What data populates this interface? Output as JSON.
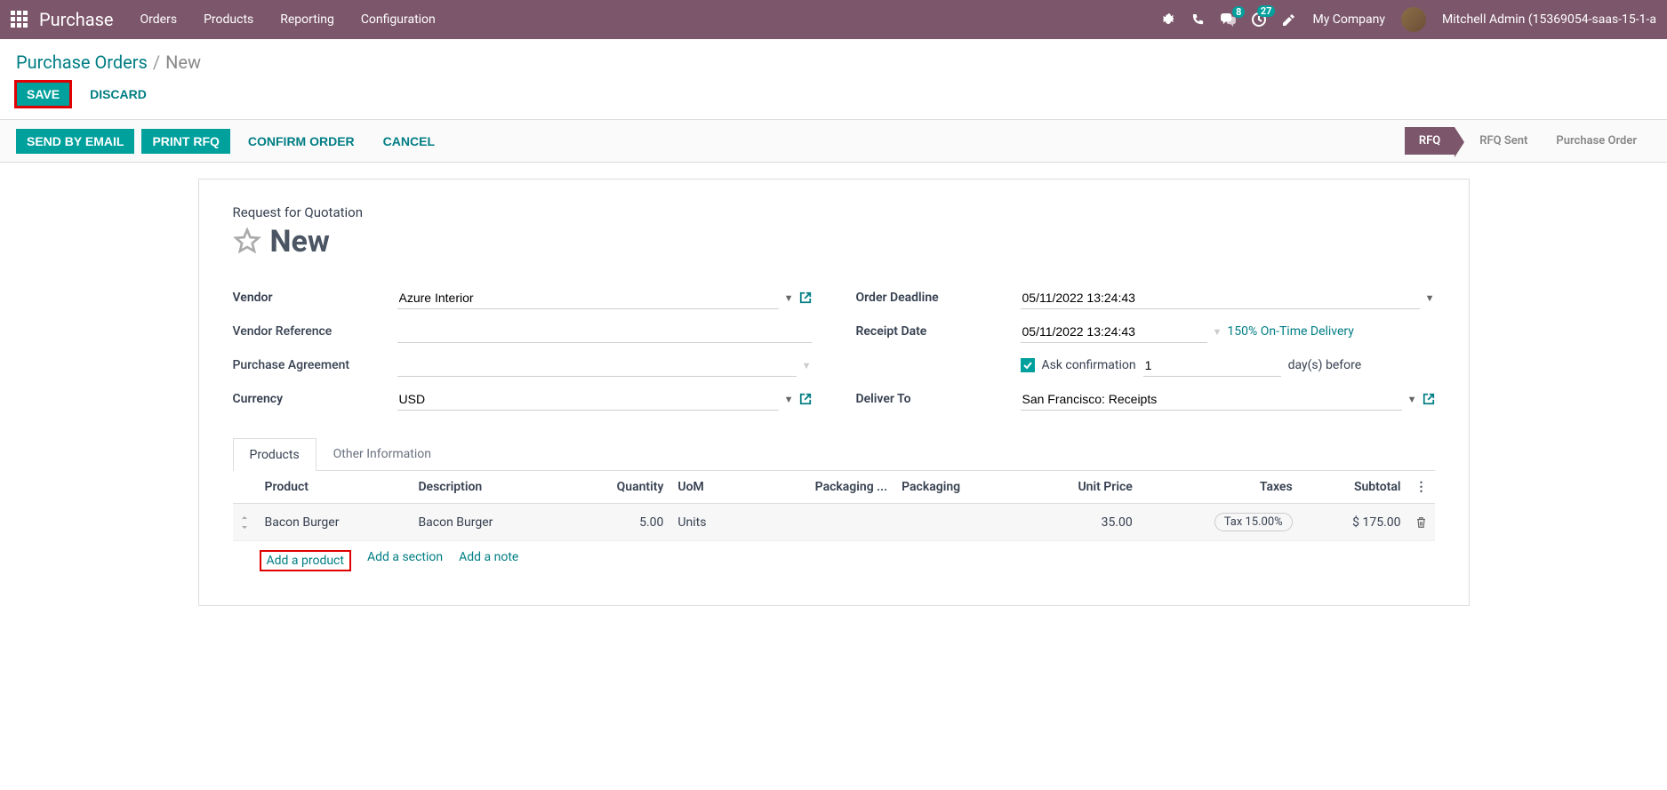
{
  "nav": {
    "app_title": "Purchase",
    "menu": [
      "Orders",
      "Products",
      "Reporting",
      "Configuration"
    ],
    "msg_count": "8",
    "activity_count": "27",
    "company": "My Company",
    "user": "Mitchell Admin (15369054-saas-15-1-a"
  },
  "breadcrumb": {
    "parent": "Purchase Orders",
    "current": "New"
  },
  "actions": {
    "save": "Save",
    "discard": "Discard"
  },
  "statusbar": {
    "send_email": "Send by Email",
    "print_rfq": "Print RFQ",
    "confirm": "Confirm Order",
    "cancel": "Cancel",
    "stages": [
      "RFQ",
      "RFQ Sent",
      "Purchase Order"
    ]
  },
  "form": {
    "subtitle": "Request for Quotation",
    "title": "New",
    "labels": {
      "vendor": "Vendor",
      "vendor_ref": "Vendor Reference",
      "purchase_agreement": "Purchase Agreement",
      "currency": "Currency",
      "order_deadline": "Order Deadline",
      "receipt_date": "Receipt Date",
      "deliver_to": "Deliver To",
      "ask_confirmation": "Ask confirmation",
      "days_before": "day(s) before"
    },
    "values": {
      "vendor": "Azure Interior",
      "vendor_ref": "",
      "purchase_agreement": "",
      "currency": "USD",
      "order_deadline": "05/11/2022 13:24:43",
      "receipt_date": "05/11/2022 13:24:43",
      "on_time_delivery": "150% On-Time Delivery",
      "ask_confirmation_days": "1",
      "deliver_to": "San Francisco: Receipts"
    }
  },
  "tabs": {
    "products": "Products",
    "other": "Other Information"
  },
  "table": {
    "headers": {
      "product": "Product",
      "description": "Description",
      "quantity": "Quantity",
      "uom": "UoM",
      "packaging_qty": "Packaging ...",
      "packaging": "Packaging",
      "unit_price": "Unit Price",
      "taxes": "Taxes",
      "subtotal": "Subtotal"
    },
    "rows": [
      {
        "product": "Bacon Burger",
        "description": "Bacon Burger",
        "quantity": "5.00",
        "uom": "Units",
        "packaging_qty": "",
        "packaging": "",
        "unit_price": "35.00",
        "taxes": "Tax 15.00%",
        "subtotal": "$ 175.00"
      }
    ],
    "add_product": "Add a product",
    "add_section": "Add a section",
    "add_note": "Add a note"
  }
}
